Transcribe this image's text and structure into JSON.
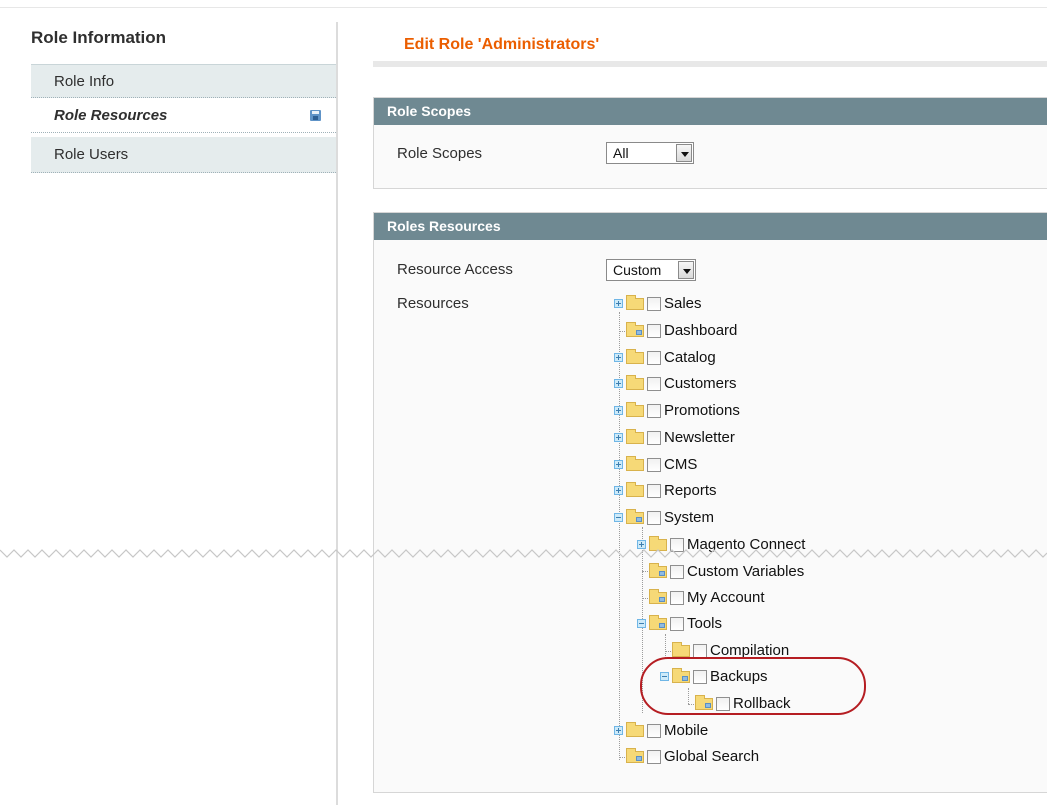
{
  "sidebar": {
    "title": "Role Information",
    "items": [
      {
        "label": "Role Info"
      },
      {
        "label": "Role Resources"
      },
      {
        "label": "Role Users"
      }
    ]
  },
  "main": {
    "title": "Edit Role 'Administrators'",
    "role_scopes": {
      "header": "Role Scopes",
      "label": "Role Scopes",
      "value": "All"
    },
    "roles_resources": {
      "header": "Roles Resources",
      "access_label": "Resource Access",
      "access_value": "Custom",
      "resources_label": "Resources"
    },
    "tree": [
      {
        "label": "Sales",
        "icon": "folder-icon",
        "expander": "plus"
      },
      {
        "label": "Dashboard",
        "icon": "folder-leaf-icon",
        "expander": "none"
      },
      {
        "label": "Catalog",
        "icon": "folder-icon",
        "expander": "plus"
      },
      {
        "label": "Customers",
        "icon": "folder-icon",
        "expander": "plus"
      },
      {
        "label": "Promotions",
        "icon": "folder-icon",
        "expander": "plus"
      },
      {
        "label": "Newsletter",
        "icon": "folder-icon",
        "expander": "plus"
      },
      {
        "label": "CMS",
        "icon": "folder-icon",
        "expander": "plus"
      },
      {
        "label": "Reports",
        "icon": "folder-icon",
        "expander": "plus"
      },
      {
        "label": "System",
        "icon": "folder-leaf-icon",
        "expander": "minus"
      },
      {
        "label": "Magento Connect",
        "icon": "folder-icon",
        "expander": "plus"
      },
      {
        "label": "Custom Variables",
        "icon": "folder-leaf-icon",
        "expander": "none"
      },
      {
        "label": "My Account",
        "icon": "folder-leaf-icon",
        "expander": "none"
      },
      {
        "label": "Tools",
        "icon": "folder-leaf-icon",
        "expander": "minus"
      },
      {
        "label": "Compilation",
        "icon": "folder-icon",
        "expander": "none"
      },
      {
        "label": "Backups",
        "icon": "folder-leaf-icon",
        "expander": "minus"
      },
      {
        "label": "Rollback",
        "icon": "folder-leaf-icon",
        "expander": "none"
      },
      {
        "label": "Mobile",
        "icon": "folder-icon",
        "expander": "plus"
      },
      {
        "label": "Global Search",
        "icon": "folder-leaf-icon",
        "expander": "none"
      }
    ]
  },
  "colors": {
    "title_accent": "#eb5e00",
    "section_header": "#6f8992",
    "tab_bg": "#e5eced",
    "highlight_ring": "#b51d22"
  }
}
